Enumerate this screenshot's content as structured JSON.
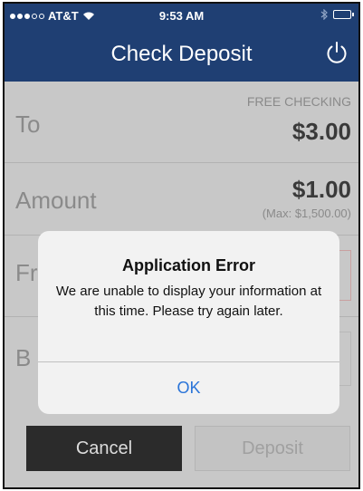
{
  "status_bar": {
    "carrier": "AT&T",
    "time": "9:53 AM"
  },
  "header": {
    "title": "Check Deposit",
    "power_icon": "power-icon"
  },
  "form": {
    "to": {
      "label": "To",
      "account_name": "FREE CHECKING",
      "balance": "$3.00"
    },
    "amount": {
      "label": "Amount",
      "value": "$1.00",
      "max_note": "(Max: $1,500.00)"
    },
    "front": {
      "label": "Fr"
    },
    "back": {
      "label": "B"
    }
  },
  "buttons": {
    "cancel": "Cancel",
    "deposit": "Deposit"
  },
  "alert": {
    "title": "Application Error",
    "message": "We are unable to display your information at this time. Please try again later.",
    "ok": "OK"
  },
  "colors": {
    "nav_bar": "#1f3f73",
    "alert_button": "#2a74d8",
    "cancel_button": "#2b2b2b"
  }
}
